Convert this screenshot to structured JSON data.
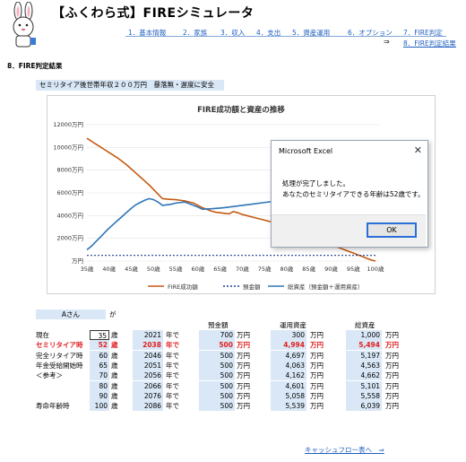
{
  "header": {
    "title": "【ふくわら式】FIREシミュレータ"
  },
  "nav": [
    {
      "label": "1．基本情報"
    },
    {
      "label": "2．家族"
    },
    {
      "label": "3．収入"
    },
    {
      "label": "4．支出"
    },
    {
      "label": "5．資産運用"
    },
    {
      "label": "6．オプション"
    },
    {
      "label": "7．FIRE判定"
    },
    {
      "label": "8．FIRE判定結果"
    }
  ],
  "nav_arrow": "⇒",
  "section_title": "8．FIRE判定結果",
  "banner": "セミリタイア後世帯年収２００万円　暴落無・遅度に安全",
  "chart_data": {
    "type": "line",
    "title": "FIRE成功額と資産の推移",
    "x": [
      35,
      36,
      37,
      38,
      39,
      40,
      41,
      42,
      43,
      44,
      45,
      46,
      47,
      48,
      49,
      50,
      51,
      52,
      53,
      54,
      55,
      56,
      57,
      58,
      59,
      60,
      61,
      62,
      63,
      64,
      65,
      66,
      67,
      68,
      69,
      70,
      71,
      72,
      73,
      74,
      75,
      76,
      77,
      78,
      79,
      80,
      81,
      82,
      83,
      84,
      85,
      86,
      87,
      88,
      89,
      90,
      91,
      92,
      93,
      94,
      95,
      96,
      97,
      98,
      99,
      100
    ],
    "x_tick_labels": [
      "35歳",
      "40歳",
      "45歳",
      "50歳",
      "55歳",
      "60歳",
      "65歳",
      "70歳",
      "75歳",
      "80歳",
      "85歳",
      "90歳",
      "95歳",
      "100歳"
    ],
    "y_tick_labels": [
      "万円",
      "2000万円",
      "4000万円",
      "6000万円",
      "8000万円",
      "10000万円",
      "12000万円"
    ],
    "ylim": [
      0,
      12000
    ],
    "series": [
      {
        "name": "FIRE成功額",
        "color": "#c55a11",
        "values": [
          10800,
          10550,
          10300,
          10050,
          9800,
          9550,
          9300,
          9050,
          8750,
          8450,
          8100,
          7750,
          7400,
          7050,
          6700,
          6300,
          5900,
          5494,
          5450,
          5420,
          5400,
          5350,
          5300,
          5200,
          5100,
          4900,
          4700,
          4550,
          4400,
          4300,
          4250,
          4200,
          4150,
          4350,
          4250,
          4100,
          4000,
          3900,
          3800,
          3700,
          3600,
          3500,
          3380,
          3250,
          3100,
          2950,
          2800,
          2650,
          2500,
          2350,
          2200,
          2050,
          1900,
          1750,
          1600,
          1450,
          1300,
          1150,
          1000,
          850,
          700,
          550,
          400,
          250,
          100,
          0
        ]
      },
      {
        "name": "預金額",
        "color": "#1f3f8f",
        "dashed": true,
        "values": [
          500,
          500,
          500,
          500,
          500,
          500,
          500,
          500,
          500,
          500,
          500,
          500,
          500,
          500,
          500,
          500,
          500,
          500,
          500,
          500,
          500,
          500,
          500,
          500,
          500,
          500,
          500,
          500,
          500,
          500,
          500,
          500,
          500,
          500,
          500,
          500,
          500,
          500,
          500,
          500,
          500,
          500,
          500,
          500,
          500,
          500,
          500,
          500,
          500,
          500,
          500,
          500,
          500,
          500,
          500,
          500,
          500,
          500,
          500,
          500,
          500,
          500,
          500,
          500,
          500,
          500
        ]
      },
      {
        "name": "総資産（預金額＋運用資産）",
        "color": "#2e75b6",
        "values": [
          1000,
          1300,
          1700,
          2100,
          2500,
          2900,
          3250,
          3600,
          3950,
          4300,
          4650,
          4950,
          5150,
          5350,
          5494,
          5400,
          5200,
          4900,
          4950,
          5000,
          5100,
          5150,
          5197,
          5050,
          4900,
          4750,
          4563,
          4580,
          4600,
          4630,
          4662,
          4700,
          4750,
          4800,
          4850,
          4900,
          4950,
          5000,
          5050,
          5101,
          5150,
          5200,
          5250,
          5300,
          5350,
          5400,
          5450,
          5500,
          5520,
          5540,
          5558,
          5600,
          5650,
          5700,
          5750,
          5800,
          5850,
          5900,
          5950,
          6000,
          6039,
          6039,
          6039,
          6039,
          6039,
          6039
        ]
      }
    ],
    "legend_position": "bottom"
  },
  "dialog": {
    "title": "Microsoft Excel",
    "close": "✕",
    "message_line1": "処理が完了しました。",
    "message_line2": "あなたのセミリタイアできる年齢は52歳です。",
    "ok_label": "OK"
  },
  "person": {
    "name": "Aさん",
    "suffix": "が"
  },
  "table_headers": {
    "deposit": "預金額",
    "investment": "運用資産",
    "total": "総資産"
  },
  "units": {
    "age": "歳",
    "year": "年で",
    "money": "万円"
  },
  "rows": [
    {
      "label": "現在",
      "age": "35",
      "year": "2021",
      "deposit": "700",
      "investment": "300",
      "total": "1,000",
      "highlight": false
    },
    {
      "label": "セミリタイア時",
      "age": "52",
      "year": "2038",
      "deposit": "500",
      "investment": "4,994",
      "total": "5,494",
      "highlight": true
    },
    {
      "label": "完全リタイア時",
      "age": "60",
      "year": "2046",
      "deposit": "500",
      "investment": "4,697",
      "total": "5,197",
      "highlight": false
    },
    {
      "label": "年金受給開始時",
      "age": "65",
      "year": "2051",
      "deposit": "500",
      "investment": "4,063",
      "total": "4,563",
      "highlight": false
    },
    {
      "label": "＜参考＞",
      "age": "70",
      "year": "2056",
      "deposit": "500",
      "investment": "4,162",
      "total": "4,662",
      "highlight": false
    },
    {
      "label": "",
      "age": "80",
      "year": "2066",
      "deposit": "500",
      "investment": "4,601",
      "total": "5,101",
      "highlight": false
    },
    {
      "label": "",
      "age": "90",
      "year": "2076",
      "deposit": "500",
      "investment": "5,058",
      "total": "5,558",
      "highlight": false
    },
    {
      "label": "寿命年齢時",
      "age": "100",
      "year": "2086",
      "deposit": "500",
      "investment": "5,539",
      "total": "6,039",
      "highlight": false
    }
  ],
  "cashflow_link": "キャッシュフロー表へ　⇒"
}
